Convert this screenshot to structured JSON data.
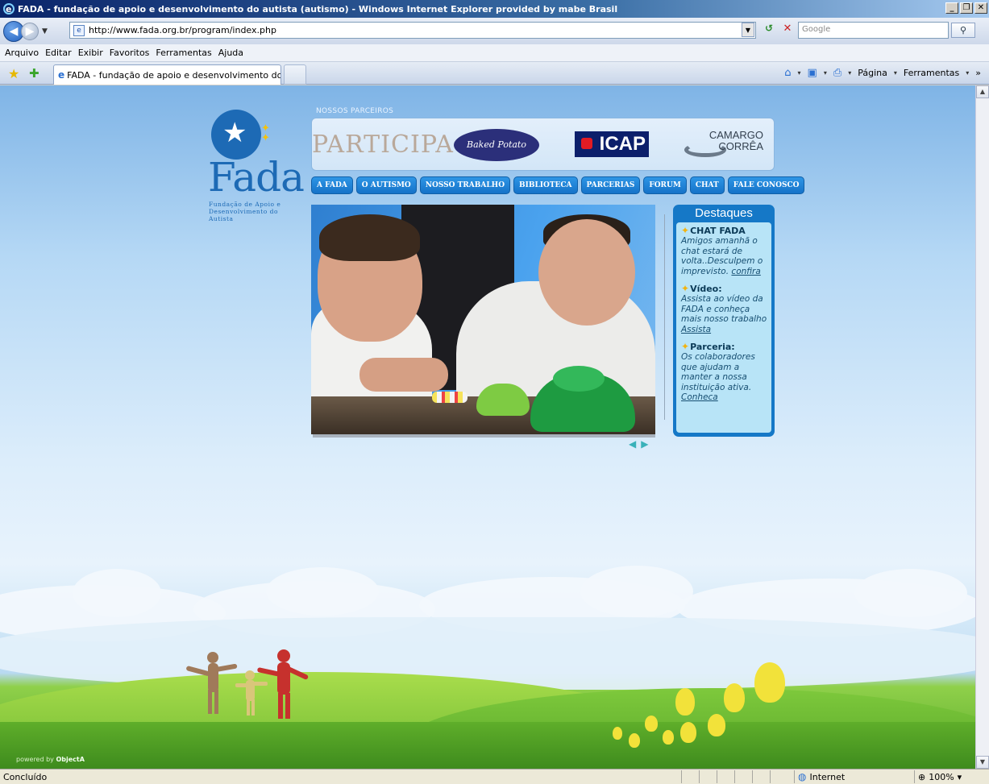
{
  "window": {
    "title": "FADA - fundação de apoio e desenvolvimento do autista (autismo) - Windows Internet Explorer provided by mabe Brasil",
    "min_label": "_",
    "max_label": "❐",
    "close_label": "✕"
  },
  "addressbar": {
    "url": "http://www.fada.org.br/program/index.php",
    "search_placeholder": "Google",
    "search_btn": "⚲",
    "back": "◀",
    "forward": "▶",
    "refresh": "↺",
    "stop": "✕",
    "dropdown": "▼"
  },
  "menubar": {
    "items": [
      "Arquivo",
      "Editar",
      "Exibir",
      "Favoritos",
      "Ferramentas",
      "Ajuda"
    ]
  },
  "tabbar": {
    "favorites_icon": "★",
    "add_favorites_icon": "✚",
    "tab_title": "FADA - fundação de apoio e desenvolvimento do auti...",
    "tab_icon": "e",
    "home_icon": "⌂",
    "feeds_icon": "▣",
    "print_icon": "⎙",
    "page_label": "Página",
    "tools_label": "Ferramentas",
    "more": "»",
    "dd": "▾"
  },
  "site": {
    "logo": {
      "word": "Fada",
      "subtitle": "Fundação de Apoio e Desenvolvimento do Autista"
    },
    "partners_label": "NOSSOS PARCEIROS",
    "partners": {
      "p1": "PARTICIPA",
      "p2": "Baked Potato",
      "p3": "ICAP",
      "p4_line1": "CAMARGO",
      "p4_line2": "CORRÊA"
    },
    "nav": [
      "A FADA",
      "O AUTISMO",
      "NOSSO TRABALHO",
      "BIBLIOTECA",
      "PARCERIAS",
      "FORUM",
      "CHAT",
      "FALE CONOSCO"
    ],
    "arrows": {
      "prev": "◀",
      "next": "▶"
    },
    "destaques": {
      "title": "Destaques",
      "items": [
        {
          "heading": "CHAT FADA",
          "text": "Amigos amanhã o chat estará de volta..Desculpem o imprevisto.",
          "link": "confira"
        },
        {
          "heading": "Vídeo:",
          "text": "Assista ao vídeo da FADA e conheça mais nosso trabalho",
          "link": "Assista"
        },
        {
          "heading": "Parceria:",
          "text": "Os colaboradores que ajudam a manter a nossa instituição ativa.",
          "link": "Conheca"
        }
      ],
      "star": "✦"
    },
    "powered_prefix": "powered by",
    "powered_brand": "ObjectA"
  },
  "statusbar": {
    "status": "Concluído",
    "zone": "Internet",
    "zoom": "100%",
    "globe": "◍",
    "zoom_icon": "⊕",
    "zoom_dd": "▾"
  },
  "scroll": {
    "up": "▲",
    "down": "▼"
  },
  "colors": {
    "nav_blue": "#1572c8",
    "logo_blue": "#1d6ab5",
    "destaques_bg": "#b8e4f7",
    "star_yellow": "#f2b30f"
  }
}
